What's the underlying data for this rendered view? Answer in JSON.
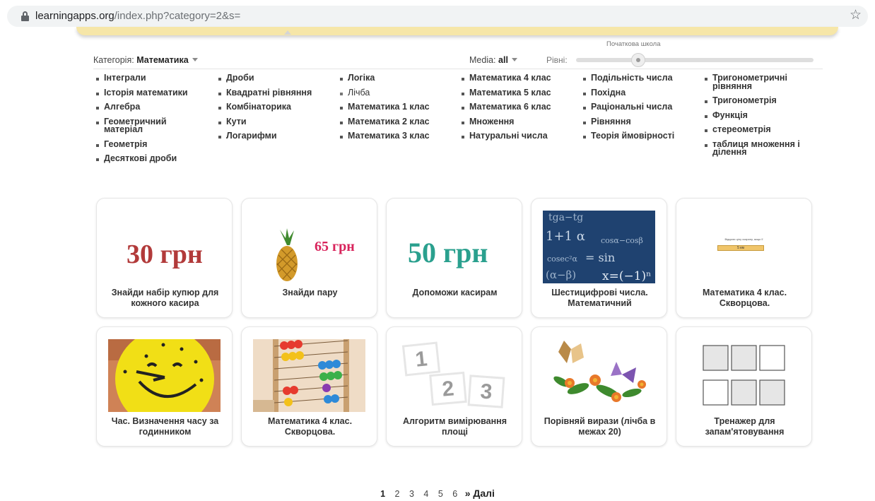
{
  "browser": {
    "url_host": "learningapps.org",
    "url_path": "/index.php?category=2&s="
  },
  "filters": {
    "category_label": "Категорія:",
    "category_value": "Математика",
    "media_label": "Media:",
    "media_value": "all",
    "levels_label": "Рівні:",
    "level_caption": "Початкова школа"
  },
  "subcategories": [
    [
      "Інтеграли",
      "Історія математики",
      "Алгебра",
      "Геометричний матеріал",
      "Геометрія",
      "Десяткові дроби"
    ],
    [
      "Дроби",
      "Квадратні рівняння",
      "Комбінаторика",
      "Кути",
      "Логарифми"
    ],
    [
      "Логіка",
      "Лічба",
      "Математика 1 клас",
      "Математика 2 клас",
      "Математика 3 клас"
    ],
    [
      "Математика 4 клас",
      "Математика 5 клас",
      "Математика 6 клас",
      "Множення",
      "Натуральні числа"
    ],
    [
      "Подільність числа",
      "Похідна",
      "Раціональні числа",
      "Рівняння",
      "Теорія ймовірності"
    ],
    [
      "Тригонометричні рівняння",
      "Тригонометрія",
      "Функція",
      "стереометрія",
      "таблиця множення і ділення"
    ]
  ],
  "cards": [
    {
      "title": "Знайди набір купюр для кожного касира",
      "price": "30 грн",
      "price_color": "#b23a3a"
    },
    {
      "title": "Знайди пару",
      "price": "65 грн",
      "price_color": "#d8245c"
    },
    {
      "title": "Допоможи касирам",
      "price": "50 грн",
      "price_color": "#2aa08e"
    },
    {
      "title": "Шестицифрові числа. Математичний"
    },
    {
      "title": "Математика 4 клас. Скворцова.",
      "thumb_text": "Відкрию цілу скарину, якщо її",
      "thumb_box": "5 км"
    },
    {
      "title": "Час. Визначення часу за годинником"
    },
    {
      "title": "Математика 4 клас. Скворцова."
    },
    {
      "title": "Алгоритм вимірювання площі",
      "tiles": [
        "1",
        "2",
        "3"
      ]
    },
    {
      "title": "Порівняй вирази (лічба в межах 20)"
    },
    {
      "title": "Тренажер для запам'ятовування"
    }
  ],
  "pager": {
    "pages": [
      "1",
      "2",
      "3",
      "4",
      "5",
      "6"
    ],
    "next_label": "» Далі"
  },
  "colors": {
    "yellow_strip": "#f6e6a8",
    "chalkboard": "#1d3d63"
  }
}
